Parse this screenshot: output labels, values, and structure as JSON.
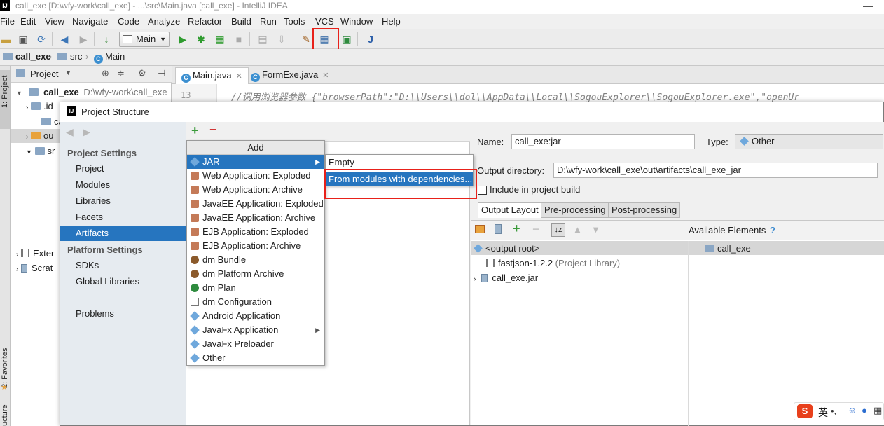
{
  "window": {
    "title": "call_exe [D:\\wfy-work\\call_exe] - ...\\src\\Main.java [call_exe] - IntelliJ IDEA",
    "logo": "IJ"
  },
  "menu": [
    "File",
    "Edit",
    "View",
    "Navigate",
    "Code",
    "Analyze",
    "Refactor",
    "Build",
    "Run",
    "Tools",
    "VCS",
    "Window",
    "Help"
  ],
  "toolbar": {
    "run_config": "Main"
  },
  "breadcrumbs": [
    "call_exe",
    "src",
    "Main"
  ],
  "side_tabs": {
    "project": "1: Project",
    "favorites": "2: Favorites",
    "structure": "ucture"
  },
  "project_panel": {
    "title": "Project",
    "root": {
      "name": "call_exe",
      "path": "D:\\wfy-work\\call_exe"
    },
    "visible_items": [
      ".id",
      "ca",
      "ou",
      "sr"
    ],
    "external": "Exter",
    "scratches": "Scrat"
  },
  "editor": {
    "tabs": [
      {
        "label": "Main.java",
        "active": true
      },
      {
        "label": "FormExe.java",
        "active": false
      }
    ],
    "line_number": "13",
    "code": "//调用浏览器参数 {\"browserPath\":\"D:\\\\Users\\\\dol\\\\AppData\\\\Local\\\\SogouExplorer\\\\SogouExplorer.exe\",\"openUr"
  },
  "dialog": {
    "title": "Project Structure",
    "project_settings_header": "Project Settings",
    "project_settings": [
      "Project",
      "Modules",
      "Libraries",
      "Facets",
      "Artifacts"
    ],
    "platform_settings_header": "Platform Settings",
    "platform_settings": [
      "SDKs",
      "Global Libraries"
    ],
    "problems": "Problems",
    "selected": "Artifacts",
    "name_label": "Name:",
    "name_value": "call_exe:jar",
    "type_label": "Type:",
    "type_value": "Other",
    "output_dir_label": "Output directory:",
    "output_dir_value": "D:\\wfy-work\\call_exe\\out\\artifacts\\call_exe_jar",
    "include_label": "Include in project build",
    "include_checked": false,
    "tabs": [
      "Output Layout",
      "Pre-processing",
      "Post-processing"
    ],
    "available_label": "Available Elements",
    "help_mark": "?",
    "output_tree": [
      {
        "label": "<output root>",
        "selected": true
      },
      {
        "label": "fastjson-1.2.2",
        "suffix": " (Project Library)"
      },
      {
        "label": "call_exe.jar"
      }
    ],
    "available_tree": [
      {
        "label": "call_exe"
      }
    ]
  },
  "add_menu": {
    "header": "Add",
    "items": [
      {
        "label": "JAR",
        "icon": "blue",
        "submenu": true,
        "selected": true
      },
      {
        "label": "Web Application: Exploded",
        "icon": "web"
      },
      {
        "label": "Web Application: Archive",
        "icon": "web"
      },
      {
        "label": "JavaEE Application: Exploded",
        "icon": "web"
      },
      {
        "label": "JavaEE Application: Archive",
        "icon": "web"
      },
      {
        "label": "EJB Application: Exploded",
        "icon": "web"
      },
      {
        "label": "EJB Application: Archive",
        "icon": "web"
      },
      {
        "label": "dm Bundle",
        "icon": "dm"
      },
      {
        "label": "dm Platform Archive",
        "icon": "dm"
      },
      {
        "label": "dm Plan",
        "icon": "green"
      },
      {
        "label": "dm Configuration",
        "icon": "file"
      },
      {
        "label": "Android Application",
        "icon": "blue"
      },
      {
        "label": "JavaFx Application",
        "icon": "blue",
        "submenu": true
      },
      {
        "label": "JavaFx Preloader",
        "icon": "blue"
      },
      {
        "label": "Other",
        "icon": "blue"
      }
    ]
  },
  "jar_submenu": [
    {
      "label": "Empty",
      "selected": false
    },
    {
      "label": "From modules with dependencies...",
      "selected": true
    }
  ],
  "ime": {
    "logo": "S",
    "lang": "英"
  },
  "colors": {
    "selection": "#2675bf",
    "highlight_box": "#e8211a",
    "add_green": "#3a9a3a"
  }
}
